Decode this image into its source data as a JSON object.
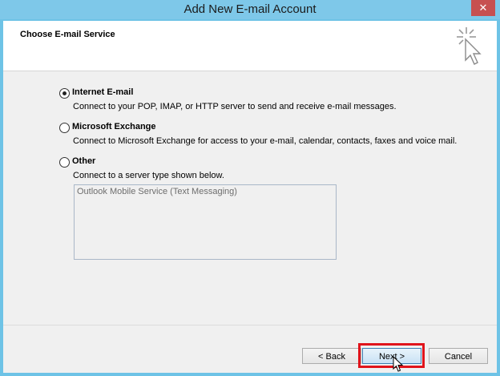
{
  "window": {
    "title": "Add New E-mail Account",
    "close_label": "✕"
  },
  "header": {
    "title": "Choose E-mail Service",
    "icon": "cursor-sparkle-icon"
  },
  "options": [
    {
      "label": "Internet E-mail",
      "description": "Connect to your POP, IMAP, or HTTP server to send and receive e-mail messages.",
      "checked": true
    },
    {
      "label": "Microsoft Exchange",
      "description": "Connect to Microsoft Exchange for access to your e-mail, calendar, contacts, faxes and voice mail.",
      "checked": false
    },
    {
      "label": "Other",
      "description": "Connect to a server type shown below.",
      "checked": false
    }
  ],
  "other_services": [
    "Outlook Mobile Service (Text Messaging)"
  ],
  "buttons": {
    "back": "< Back",
    "next": "Next >",
    "cancel": "Cancel"
  }
}
